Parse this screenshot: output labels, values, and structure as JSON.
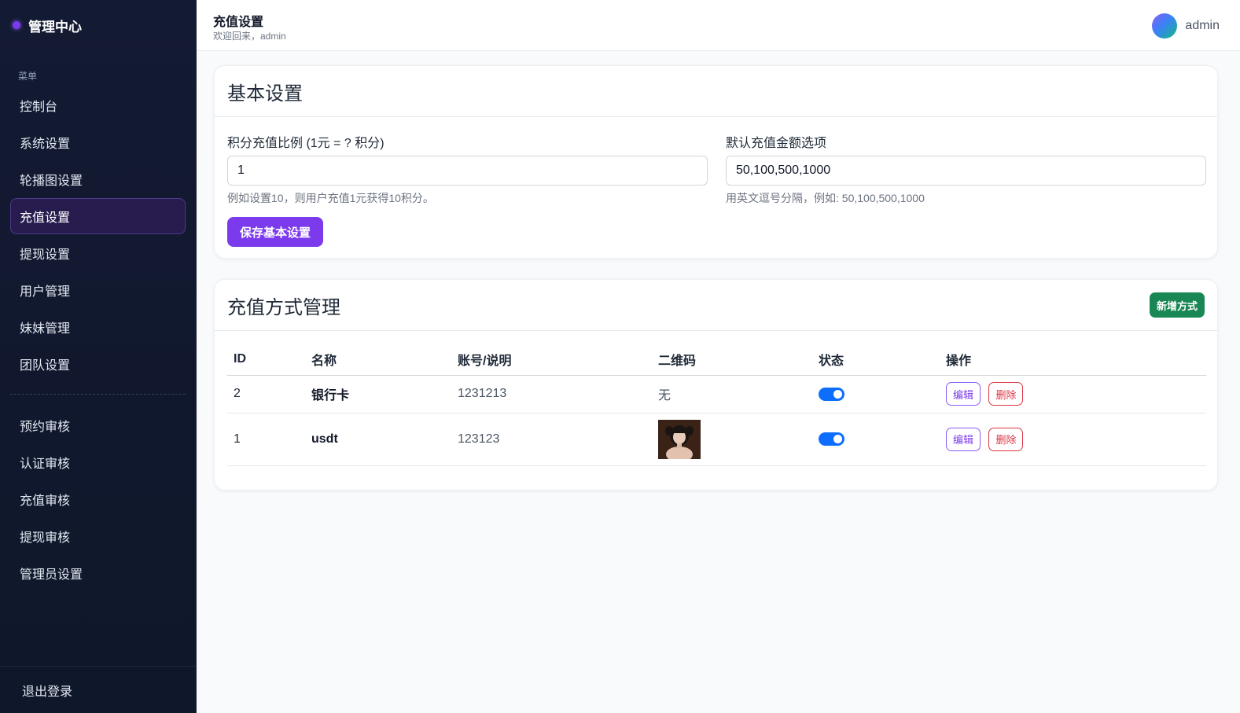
{
  "sidebar": {
    "brand": "管理中心",
    "menu_label": "菜单",
    "items": [
      {
        "label": "控制台"
      },
      {
        "label": "系统设置"
      },
      {
        "label": "轮播图设置"
      },
      {
        "label": "充值设置"
      },
      {
        "label": "提现设置"
      },
      {
        "label": "用户管理"
      },
      {
        "label": "妹妹管理"
      },
      {
        "label": "团队设置"
      }
    ],
    "items2": [
      {
        "label": "预约审核"
      },
      {
        "label": "认证审核"
      },
      {
        "label": "充值审核"
      },
      {
        "label": "提现审核"
      },
      {
        "label": "管理员设置"
      }
    ],
    "active_item": "充值设置",
    "logout": "退出登录"
  },
  "header": {
    "title": "充值设置",
    "subtitle": "欢迎回来，admin",
    "username": "admin"
  },
  "basic": {
    "title": "基本设置",
    "ratio_label": "积分充值比例 (1元 = ? 积分)",
    "ratio_value": "1",
    "ratio_help": "例如设置10，则用户充值1元获得10积分。",
    "amount_label": "默认充值金额选项",
    "amount_value": "50,100,500,1000",
    "amount_help": "用英文逗号分隔，例如: 50,100,500,1000",
    "save_label": "保存基本设置"
  },
  "methods": {
    "title": "充值方式管理",
    "add_label": "新增方式",
    "columns": [
      "ID",
      "名称",
      "账号/说明",
      "二维码",
      "状态",
      "操作"
    ],
    "rows": [
      {
        "id": "2",
        "name": "银行卡",
        "account": "1231213",
        "qr": "无",
        "enabled": true,
        "edit": "编辑",
        "delete": "删除"
      },
      {
        "id": "1",
        "name": "usdt",
        "account": "123123",
        "qr": "image",
        "enabled": true,
        "edit": "编辑",
        "delete": "删除"
      }
    ]
  },
  "colors": {
    "accent": "#7c3aed",
    "success": "#198754",
    "danger": "#dc3545",
    "toggle": "#0d6efd",
    "sidebar_bg": "#0f172a"
  }
}
